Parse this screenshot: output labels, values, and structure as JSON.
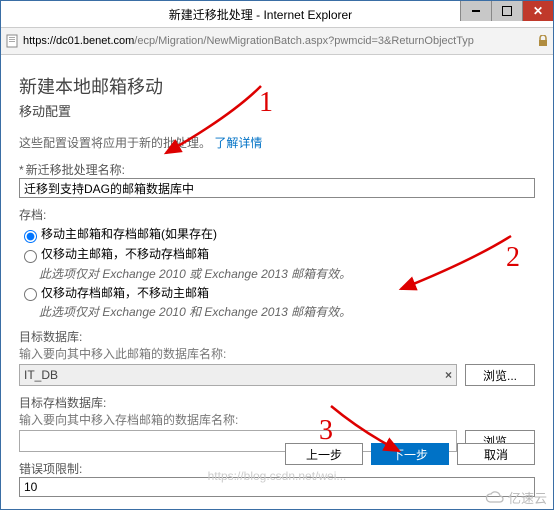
{
  "window": {
    "title": "新建迁移批处理 - Internet Explorer",
    "url_main": "https://dc01.benet.com",
    "url_rest": "/ecp/Migration/NewMigrationBatch.aspx?pwmcid=3&ReturnObjectTyp"
  },
  "page": {
    "heading": "新建本地邮箱移动",
    "subheading": "移动配置",
    "intro_text": "这些配置设置将应用于新的批处理。",
    "learn_more": "了解详情"
  },
  "batch_name": {
    "label": "新迁移批处理名称:",
    "value": "迁移到支持DAG的邮箱数据库中"
  },
  "archive": {
    "group_label": "存档:",
    "opt1": "移动主邮箱和存档邮箱(如果存在)",
    "opt2": "仅移动主邮箱，不移动存档邮箱",
    "opt2_note": "此选项仅对 Exchange 2010 或 Exchange 2013 邮箱有效。",
    "opt3": "仅移动存档邮箱，不移动主邮箱",
    "opt3_note": "此选项仅对 Exchange 2010 和 Exchange 2013 邮箱有效。",
    "selected": 1
  },
  "target_db": {
    "label": "目标数据库:",
    "help": "输入要向其中移入此邮箱的数据库名称:",
    "value": "IT_DB",
    "clear": "×",
    "browse": "浏览..."
  },
  "archive_db": {
    "label": "目标存档数据库:",
    "help": "输入要向其中移入存档邮箱的数据库名称:",
    "value": "",
    "browse": "浏览..."
  },
  "bad_items": {
    "label": "错误项限制:",
    "value": "10"
  },
  "buttons": {
    "back": "上一步",
    "next": "下一步",
    "cancel": "取消"
  },
  "watermark": "https://blog.csdn.net/wei...",
  "brand": "亿速云",
  "annotations": {
    "a1": "1",
    "a2": "2",
    "a3": "3"
  }
}
